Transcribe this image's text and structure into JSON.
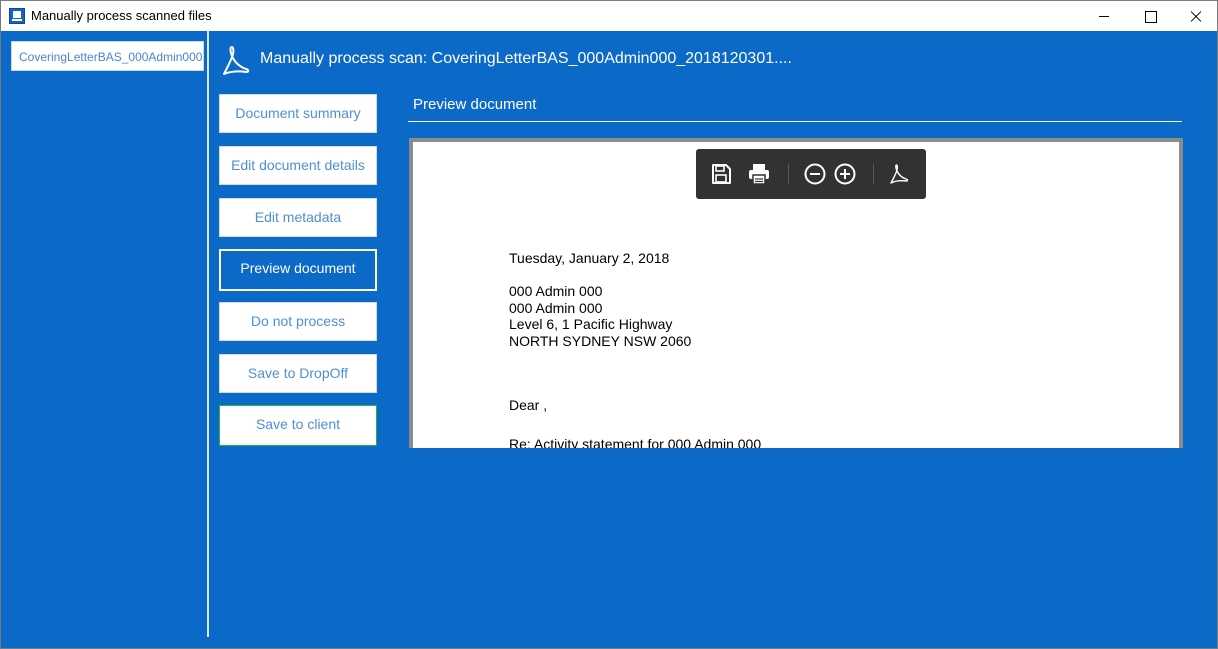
{
  "window": {
    "title": "Manually process scanned files"
  },
  "file_list": {
    "items": [
      "CoveringLetterBAS_000Admin000..."
    ]
  },
  "header": {
    "title": "Manually process scan: CoveringLetterBAS_000Admin000_2018120301...."
  },
  "nav": {
    "items": [
      {
        "label": "Document summary",
        "state": "default"
      },
      {
        "label": "Edit document details",
        "state": "default"
      },
      {
        "label": "Edit metadata",
        "state": "default"
      },
      {
        "label": "Preview document",
        "state": "active"
      },
      {
        "label": "Do not process",
        "state": "default"
      },
      {
        "label": "Save to DropOff",
        "state": "default"
      },
      {
        "label": "Save to client",
        "state": "highlight-green"
      }
    ]
  },
  "preview": {
    "section_title": "Preview document",
    "toolbar": {
      "icons": [
        "save-icon",
        "print-icon",
        "zoom-out-icon",
        "zoom-in-icon",
        "acrobat-icon"
      ]
    },
    "letter": {
      "date": "Tuesday, January 2, 2018",
      "address": [
        "000 Admin 000",
        "000 Admin 000",
        "Level 6, 1 Pacific Highway",
        "NORTH SYDNEY NSW 2060"
      ],
      "salutation": "Dear ,",
      "subject": "Re: Activity statement for 000 Admin 000"
    }
  },
  "colors": {
    "background": "#0b69c7",
    "button_text": "#4f8fd4",
    "toolbar": "#323232",
    "green_border": "#21b24a"
  }
}
